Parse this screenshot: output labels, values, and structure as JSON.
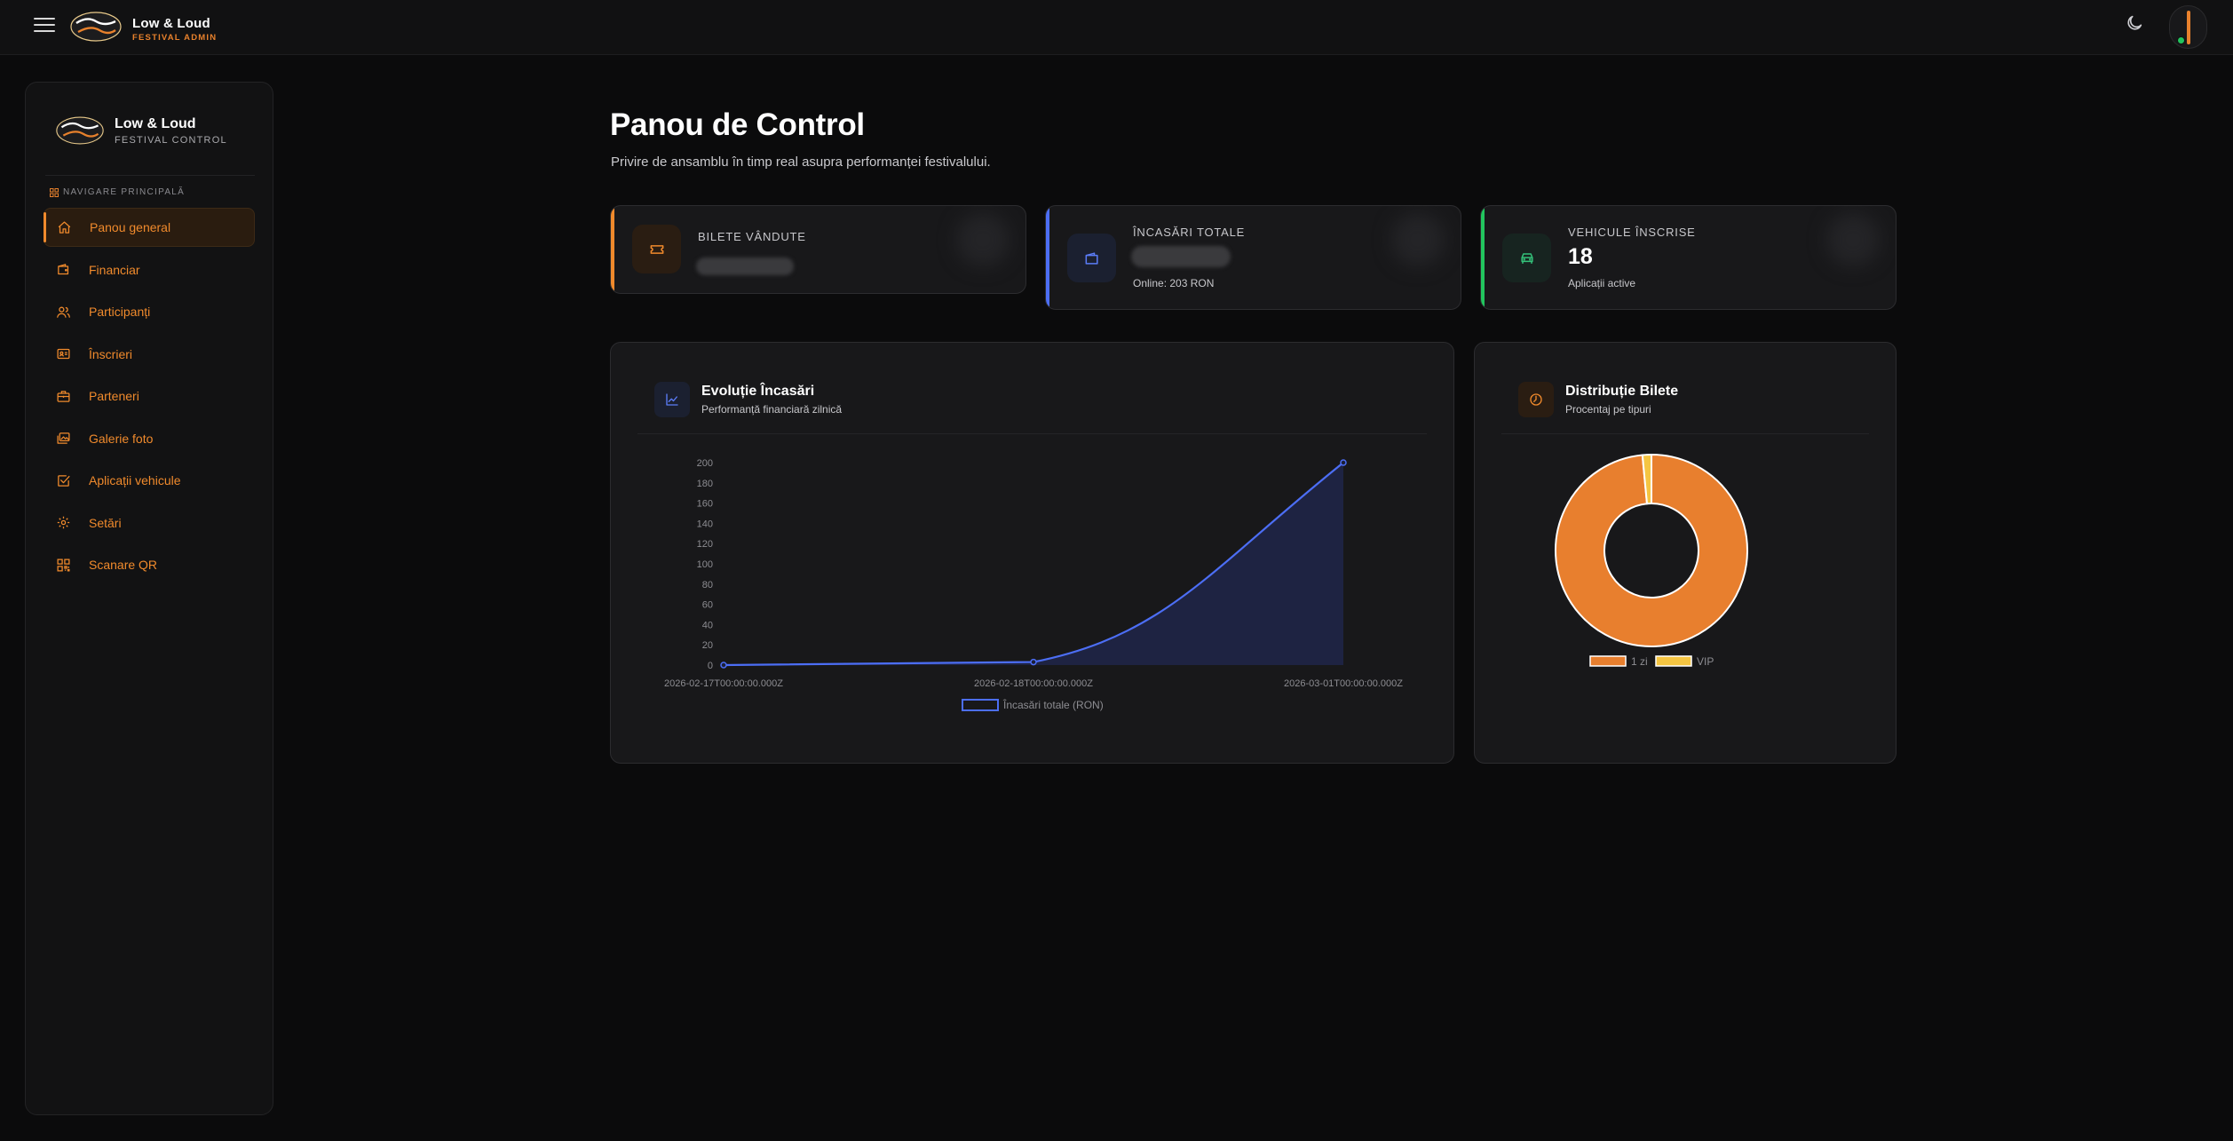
{
  "topbar": {
    "brand_name": "Low & Loud",
    "brand_sub": "FESTIVAL ADMIN"
  },
  "sidebar": {
    "brand_name": "Low & Loud",
    "brand_sub": "FESTIVAL CONTROL",
    "nav_heading": "NAVIGARE PRINCIPALĂ",
    "items": [
      {
        "label": "Panou general",
        "icon": "home-icon",
        "active": true
      },
      {
        "label": "Financiar",
        "icon": "wallet-icon"
      },
      {
        "label": "Participanți",
        "icon": "users-icon"
      },
      {
        "label": "Înscrieri",
        "icon": "id-card-icon"
      },
      {
        "label": "Parteneri",
        "icon": "briefcase-icon"
      },
      {
        "label": "Galerie foto",
        "icon": "images-icon"
      },
      {
        "label": "Aplicații vehicule",
        "icon": "check-square-icon"
      },
      {
        "label": "Setări",
        "icon": "gear-icon"
      },
      {
        "label": "Scanare QR",
        "icon": "qr-icon"
      }
    ]
  },
  "page": {
    "title": "Panou de Control",
    "subtitle": "Privire de ansamblu în timp real asupra performanței festivalului."
  },
  "stats": {
    "tickets": {
      "label": "BILETE VÂNDUTE",
      "accent": "#f08a2c"
    },
    "revenue": {
      "label": "ÎNCASĂRI TOTALE",
      "foot": "Online: 203 RON",
      "accent": "#4c6ef5"
    },
    "vehicles": {
      "label": "VEHICULE ÎNSCRISE",
      "value": "18",
      "foot": "Aplicații active",
      "accent": "#22c55e"
    }
  },
  "revenue_panel": {
    "title": "Evoluție Încasări",
    "subtitle": "Performanță financiară zilnică"
  },
  "tickets_panel": {
    "title": "Distribuție Bilete",
    "subtitle": "Procentaj pe tipuri"
  },
  "chart_data": [
    {
      "type": "area",
      "x": [
        "2026-02-17T00:00:00.000Z",
        "2026-02-18T00:00:00.000Z",
        "2026-03-01T00:00:00.000Z"
      ],
      "series": [
        {
          "name": "Încasări totale (RON)",
          "values": [
            0,
            3,
            200
          ],
          "color": "#4c6ef5"
        }
      ],
      "yticks": [
        0,
        20,
        40,
        60,
        80,
        100,
        120,
        140,
        160,
        180,
        200
      ],
      "ylim": [
        0,
        200
      ],
      "legend": "bottom"
    },
    {
      "type": "pie",
      "variant": "doughnut",
      "labels": [
        "1 zi",
        "VIP"
      ],
      "values": [
        98.5,
        1.5
      ],
      "colors": [
        "#e87f2e",
        "#f5c542"
      ],
      "legend": "bottom"
    }
  ]
}
